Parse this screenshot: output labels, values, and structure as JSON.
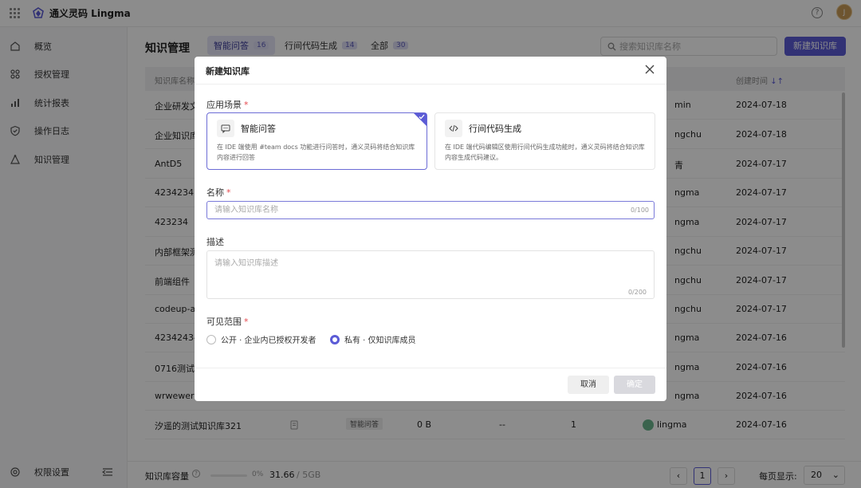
{
  "app": {
    "title": "通义灵码 Lingma",
    "avatar_letter": "J"
  },
  "sidebar": {
    "items": [
      {
        "label": "概览",
        "icon": "home-icon"
      },
      {
        "label": "授权管理",
        "icon": "authorize-icon"
      },
      {
        "label": "统计报表",
        "icon": "chart-icon"
      },
      {
        "label": "操作日志",
        "icon": "shield-icon"
      },
      {
        "label": "知识管理",
        "icon": "knowledge-icon"
      }
    ],
    "settings_label": "权限设置"
  },
  "main": {
    "title": "知识管理",
    "tabs": [
      {
        "label": "智能问答",
        "count": "16"
      },
      {
        "label": "行间代码生成",
        "count": "14"
      },
      {
        "label": "全部",
        "count": "30"
      }
    ],
    "search_placeholder": "搜索知识库名称",
    "new_button": "新建知识库",
    "columns": {
      "name": "知识库名称",
      "created": "创建时间"
    },
    "rows": [
      {
        "name": "企业研发文",
        "user": "min",
        "date": "2024-07-18"
      },
      {
        "name": "企业知识库",
        "user": "ngchu",
        "date": "2024-07-18"
      },
      {
        "name": "AntD5",
        "user": "青",
        "date": "2024-07-17"
      },
      {
        "name": "4234234",
        "user": "ngma",
        "date": "2024-07-17"
      },
      {
        "name": "423234",
        "user": "ngma",
        "date": "2024-07-17"
      },
      {
        "name": "内部框架测",
        "user": "ngchu",
        "date": "2024-07-17"
      },
      {
        "name": "前端组件",
        "user": "ngchu",
        "date": "2024-07-17"
      },
      {
        "name": "codeup-ap",
        "user": "ngchu",
        "date": "2024-07-17"
      },
      {
        "name": "42342434",
        "user": "ngma",
        "date": "2024-07-16"
      },
      {
        "name": "0716测试",
        "user": "ngma",
        "date": "2024-07-16"
      },
      {
        "name": "wrwewer",
        "user": "ngma",
        "date": "2024-07-16"
      },
      {
        "name": "汐遥的测试知识库321",
        "tag": "智能问答",
        "size": "0 B",
        "docs": "--",
        "count": "1",
        "user": "lingma",
        "date": "2024-07-16"
      }
    ],
    "footer": {
      "capacity_label": "知识库容量",
      "capacity_percent": "0%",
      "capacity_used": "31.66",
      "capacity_total": "/ 5GB",
      "page": "1",
      "page_size_label": "每页显示:",
      "page_size": "20"
    }
  },
  "modal": {
    "title": "新建知识库",
    "scene_label": "应用场景",
    "cards": [
      {
        "title": "智能问答",
        "desc": "在 IDE 端使用 #team docs 功能进行问答时，通义灵码将结合知识库内容进行回答",
        "selected": true
      },
      {
        "title": "行间代码生成",
        "desc": "在 IDE 端代码编辑区使用行间代码生成功能时，通义灵码将结合知识库内容生成代码建议。",
        "selected": false
      }
    ],
    "name_label": "名称",
    "name_placeholder": "请输入知识库名称",
    "name_count": "0/100",
    "desc_label": "描述",
    "desc_placeholder": "请输入知识库描述",
    "desc_count": "0/200",
    "visibility_label": "可见范围",
    "visibility_options": [
      {
        "label": "公开 · 企业内已授权开发者",
        "selected": false
      },
      {
        "label": "私有 · 仅知识库成员",
        "selected": true
      }
    ],
    "cancel": "取消",
    "confirm": "确定"
  }
}
